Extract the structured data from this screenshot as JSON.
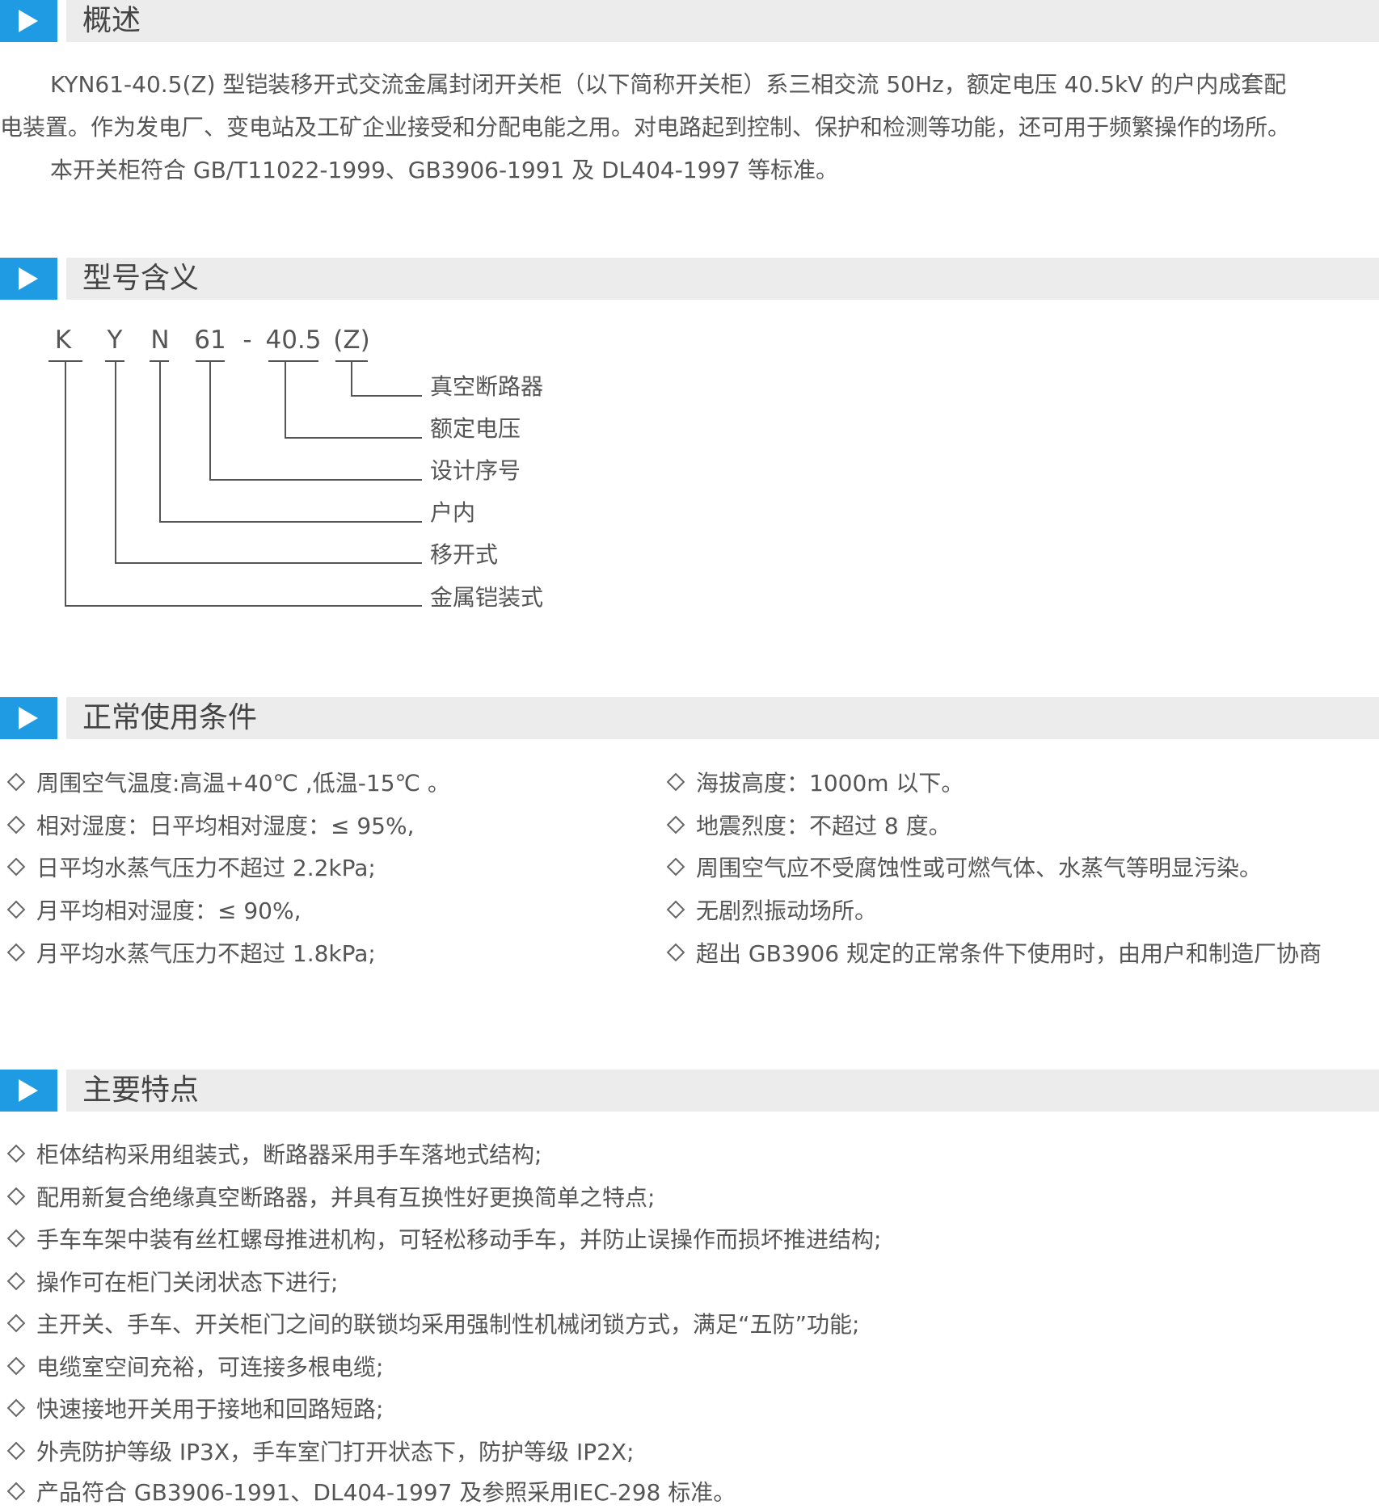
{
  "sections": {
    "overview": {
      "title": "概述",
      "para1_line1": "KYN61-40.5(Z) 型铠装移开式交流金属封闭开关柜（以下简称开关柜）系三相交流 50Hz，额定电压 40.5kV 的户内成套配",
      "para1_line2": "电装置。作为发电厂、变电站及工矿企业接受和分配电能之用。对电路起到控制、保护和检测等功能，还可用于频繁操作的场所。",
      "para2": "本开关柜符合 GB/T11022-1999、GB3906-1991 及 DL404-1997 等标准。"
    },
    "model": {
      "title": "型号含义",
      "letters": [
        "K",
        "Y",
        "N",
        "61",
        "-",
        "40.5",
        "(Z)"
      ],
      "labels": [
        "真空断路器",
        "额定电压",
        "设计序号",
        "户内",
        "移开式",
        "金属铠装式"
      ]
    },
    "conditions": {
      "title": "正常使用条件",
      "left": [
        "周围空气温度:高温+40℃ ,低温-15℃ 。",
        "相对湿度：日平均相对湿度：≤ 95%,",
        "日平均水蒸气压力不超过 2.2kPa;",
        "月平均相对湿度：≤ 90%,",
        "月平均水蒸气压力不超过 1.8kPa;"
      ],
      "right": [
        "海拔高度：1000m 以下。",
        "地震烈度：不超过 8 度。",
        "周围空气应不受腐蚀性或可燃气体、水蒸气等明显污染。",
        "无剧烈振动场所。",
        "超出 GB3906 规定的正常条件下使用时，由用户和制造厂协商"
      ]
    },
    "features": {
      "title": "主要特点",
      "items": [
        "柜体结构采用组装式，断路器采用手车落地式结构;",
        "配用新复合绝缘真空断路器，并具有互换性好更换简单之特点;",
        "手车车架中装有丝杠螺母推进机构，可轻松移动手车，并防止误操作而损坏推进结构;",
        "操作可在柜门关闭状态下进行;",
        "主开关、手车、开关柜门之间的联锁均采用强制性机械闭锁方式，满足“五防”功能;",
        "电缆室空间充裕，可连接多根电缆;",
        "快速接地开关用于接地和回路短路;",
        "外壳防护等级 IP3X，手车室门打开状态下，防护等级 IP2X;",
        "产品符合 GB3906-1991、DL404-1997 及参照采用IEC-298 标准。"
      ]
    }
  },
  "colors": {
    "accent": "#1f9be3",
    "bar": "#ececec",
    "text": "#555555"
  },
  "icons": {
    "section_marker": "play-triangle-icon",
    "bullet": "diamond-outline-icon"
  }
}
